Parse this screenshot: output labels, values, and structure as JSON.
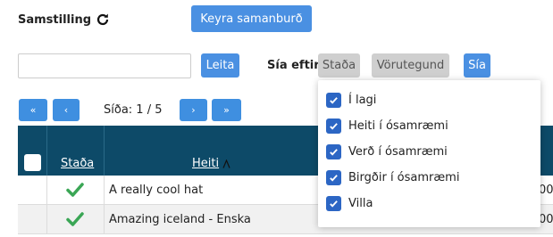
{
  "toolbar": {
    "title": "Samstilling",
    "run_button": "Keyra samanburð"
  },
  "search": {
    "value": "",
    "placeholder": "",
    "button": "Leita"
  },
  "filter": {
    "label": "Sía eftir",
    "status_button": "Staða",
    "product_group_button": "Vörutegund",
    "filter_button": "Sía"
  },
  "pagination": {
    "first": "«",
    "prev": "‹",
    "page_text": "Síða: 1 / 5",
    "next": "›",
    "last": "»"
  },
  "table": {
    "columns": {
      "status": "Staða",
      "name": "Heiti"
    },
    "rows": [
      {
        "status_icon": "check-icon",
        "name": "A really cool hat",
        "clipped_value": "00"
      },
      {
        "status_icon": "check-icon",
        "name": "Amazing iceland - Enska",
        "clipped_value": "00"
      }
    ]
  },
  "status_dropdown": {
    "options": [
      {
        "label": "Í lagi",
        "checked": true
      },
      {
        "label": "Heiti í ósamræmi",
        "checked": true
      },
      {
        "label": "Verð í ósamræmi",
        "checked": true
      },
      {
        "label": "Birgðir í ósamræmi",
        "checked": true
      },
      {
        "label": "Villa",
        "checked": true
      }
    ]
  },
  "colors": {
    "accent": "#4a90e2",
    "table_header": "#0d4a68",
    "check": "#3aa655",
    "checkbox": "#2c66c4"
  }
}
